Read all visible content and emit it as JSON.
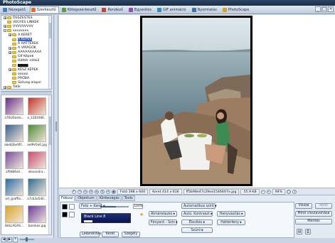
{
  "app": {
    "title": "PhotoScape"
  },
  "tabs": [
    {
      "label": "Nézegető",
      "color": "#4a7ac0"
    },
    {
      "label": "Szerkesztő",
      "color": "#e0702b"
    },
    {
      "label": "Kötegszerkesztő",
      "color": "#5a9a3c"
    },
    {
      "label": "Rendező",
      "color": "#c8422e"
    },
    {
      "label": "Egyesítés",
      "color": "#8e4fb0"
    },
    {
      "label": "GIF animáció",
      "color": "#2e8db8"
    },
    {
      "label": "Nyomtatás",
      "color": "#3d6fb3"
    },
    {
      "label": "PhotoScape",
      "color": "#d9a21f"
    }
  ],
  "window_buttons": [
    "_",
    "□",
    "×"
  ],
  "tree": [
    {
      "label": "ÖSSZESTES",
      "indent": 1,
      "exp": "+"
    },
    {
      "label": "VEGYES LINKEK",
      "indent": 1,
      "exp": ""
    },
    {
      "label": "VVVVVVVVV",
      "indent": 1,
      "exp": "+"
    },
    {
      "label": "xxxxxxxx",
      "indent": 1,
      "exp": "-"
    },
    {
      "label": "A KERET",
      "indent": 2,
      "exp": "+"
    },
    {
      "label": "A KÉPEK",
      "indent": 2,
      "exp": ""
    },
    {
      "label": "A HÁTTEREK",
      "indent": 2,
      "exp": ""
    },
    {
      "label": "A VIRÁGOK",
      "indent": 2,
      "exp": "+"
    },
    {
      "label": "AAAAAAAAAA",
      "indent": 2,
      "exp": "+"
    },
    {
      "label": "Gif Képek",
      "indent": 2,
      "exp": ""
    },
    {
      "label": "Háttér nélkül",
      "indent": 2,
      "exp": ""
    },
    {
      "label": "▆▆▆▆",
      "indent": 2,
      "exp": ""
    },
    {
      "label": "KÉSZ KÉPEK",
      "indent": 2,
      "exp": "+"
    },
    {
      "label": "ooooo",
      "indent": 2,
      "exp": ""
    },
    {
      "label": "PRÓBA",
      "indent": 2,
      "exp": ""
    },
    {
      "label": "Szöveg alapol",
      "indent": 2,
      "exp": ""
    },
    {
      "label": "Tatik",
      "indent": 1,
      "exp": "+"
    }
  ],
  "thumbnails": [
    {
      "caption": "a76l26oste...",
      "color": "#6a2d8a"
    },
    {
      "caption": "a_1281080...",
      "color": "#c2352b"
    },
    {
      "caption": "abe82bef4f...",
      "color": "#3b5f8d"
    },
    {
      "caption": "ae9fe5e0.jpg",
      "color": "#4c8b3a"
    },
    {
      "caption": "af9d84e4...",
      "color": "#7a4e9c"
    },
    {
      "caption": "alexandra...",
      "color": "#c84d73"
    },
    {
      "caption": "art_graffia...",
      "color": "#2a6aa8"
    },
    {
      "caption": "a7cb3a540...",
      "color": "#2f6e8f"
    },
    {
      "caption": "BALLAGAS...",
      "color": "#d9a52a"
    },
    {
      "caption": "bambas.jpg",
      "color": "#6b3b9b"
    }
  ],
  "leftbar_buttons": [
    "◀",
    "▶",
    "↑"
  ],
  "status": {
    "nav_icons": [
      "↶",
      "↷",
      "⟲",
      "⟳",
      "⇆",
      "⇅",
      "✦",
      "▣"
    ],
    "size": "Fotó 398 x 600",
    "frame": "Keret 414 x 616",
    "filename": "ff5b98e47c29ea1546607e.jpg",
    "filesize": "55.9 KB",
    "zoom": "94%"
  },
  "panel": {
    "tabs": [
      "Fókusz",
      "Objektum",
      "Körbevágás",
      "Tools"
    ],
    "active_tab": 0,
    "photo_frame": "Fotó + Keret",
    "percent": "100%",
    "progress": 0.55,
    "frame_name": "Black Line 8",
    "buttons": {
      "lekerekites": "Lekerekítés",
      "keret": "Keret",
      "szegely": "Szegély",
      "atmeretezes": "Átméretezés",
      "fenyero": "Fényerő - Szín",
      "auto_szint": "Automatikus szint",
      "auto_kontraszt": "Auto. Kontraszt",
      "elesites": "Élesítés",
      "szuro": "Szűrő",
      "hanyvas": "Hanyvasítás",
      "hattervilag": "Háttérfény",
      "vissza": "Vissza",
      "redo": "Redo",
      "mind_vissza": "Mind visszavonása",
      "mentes": "Mentés"
    }
  },
  "colors": {
    "titlebar": "#1b2d45",
    "accent": "#0a1652",
    "star": "#e0a800"
  }
}
